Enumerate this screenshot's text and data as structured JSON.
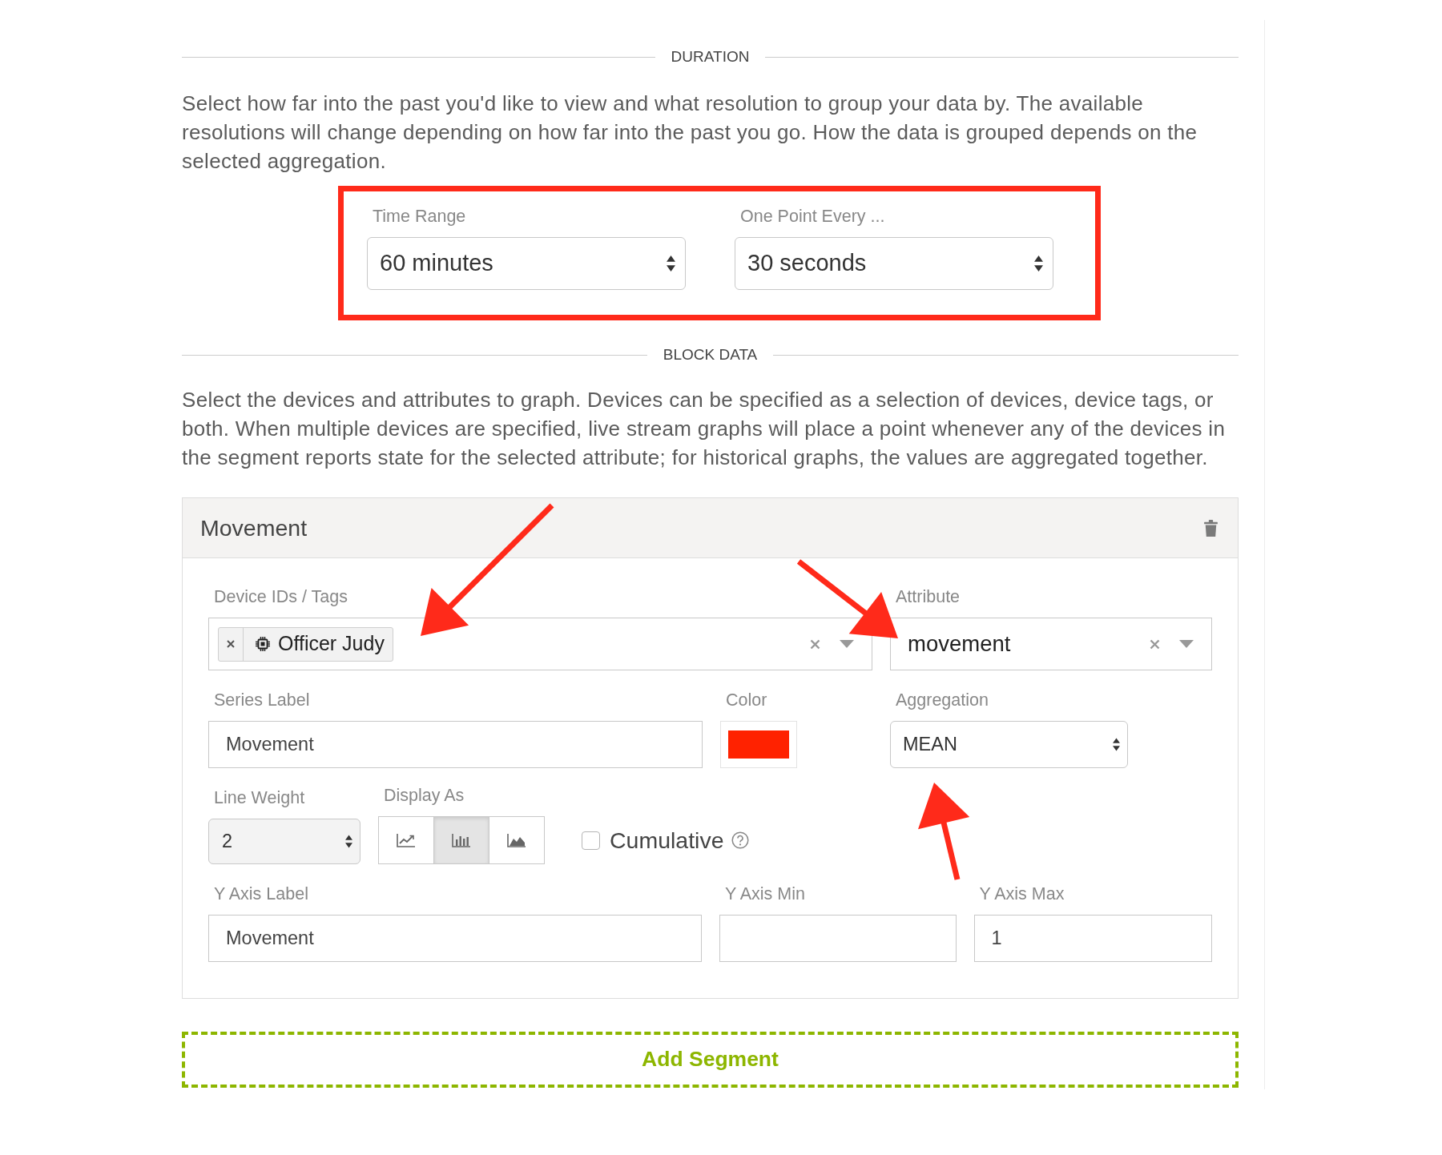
{
  "duration": {
    "heading": "DURATION",
    "description": "Select how far into the past you'd like to view and what resolution to group your data by. The available resolutions will change depending on how far into the past you go. How the data is grouped depends on the selected aggregation.",
    "highlighted": true,
    "time_range": {
      "label": "Time Range",
      "value": "60 minutes"
    },
    "resolution": {
      "label": "One Point Every ...",
      "value": "30 seconds"
    }
  },
  "block_data": {
    "heading": "BLOCK DATA",
    "description": "Select the devices and attributes to graph. Devices can be specified as a selection of devices, device tags, or both. When multiple devices are specified, live stream graphs will place a point whenever any of the devices in the segment reports state for the selected attribute; for historical graphs, the values are aggregated together."
  },
  "segment": {
    "title": "Movement",
    "devices": {
      "label": "Device IDs / Tags",
      "tags": [
        {
          "name": "Officer Judy"
        }
      ]
    },
    "attribute": {
      "label": "Attribute",
      "value": "movement"
    },
    "series_label": {
      "label": "Series Label",
      "value": "Movement"
    },
    "color_picker": {
      "label": "Color",
      "color": "#ff2200"
    },
    "aggregation": {
      "label": "Aggregation",
      "value": "MEAN"
    },
    "line_weight": {
      "label": "Line Weight",
      "value": "2"
    },
    "display_as": {
      "label": "Display As",
      "options": [
        {
          "kind": "line",
          "selected": false
        },
        {
          "kind": "bar",
          "selected": true
        },
        {
          "kind": "area",
          "selected": false
        }
      ]
    },
    "cumulative": {
      "label": "Cumulative",
      "checked": false
    },
    "y_axis_label": {
      "label": "Y Axis Label",
      "value": "Movement"
    },
    "y_axis_min": {
      "label": "Y Axis Min"
    },
    "y_axis_max": {
      "label": "Y Axis Max",
      "value": "1"
    }
  },
  "add_button": {
    "label": "Add Segment"
  }
}
